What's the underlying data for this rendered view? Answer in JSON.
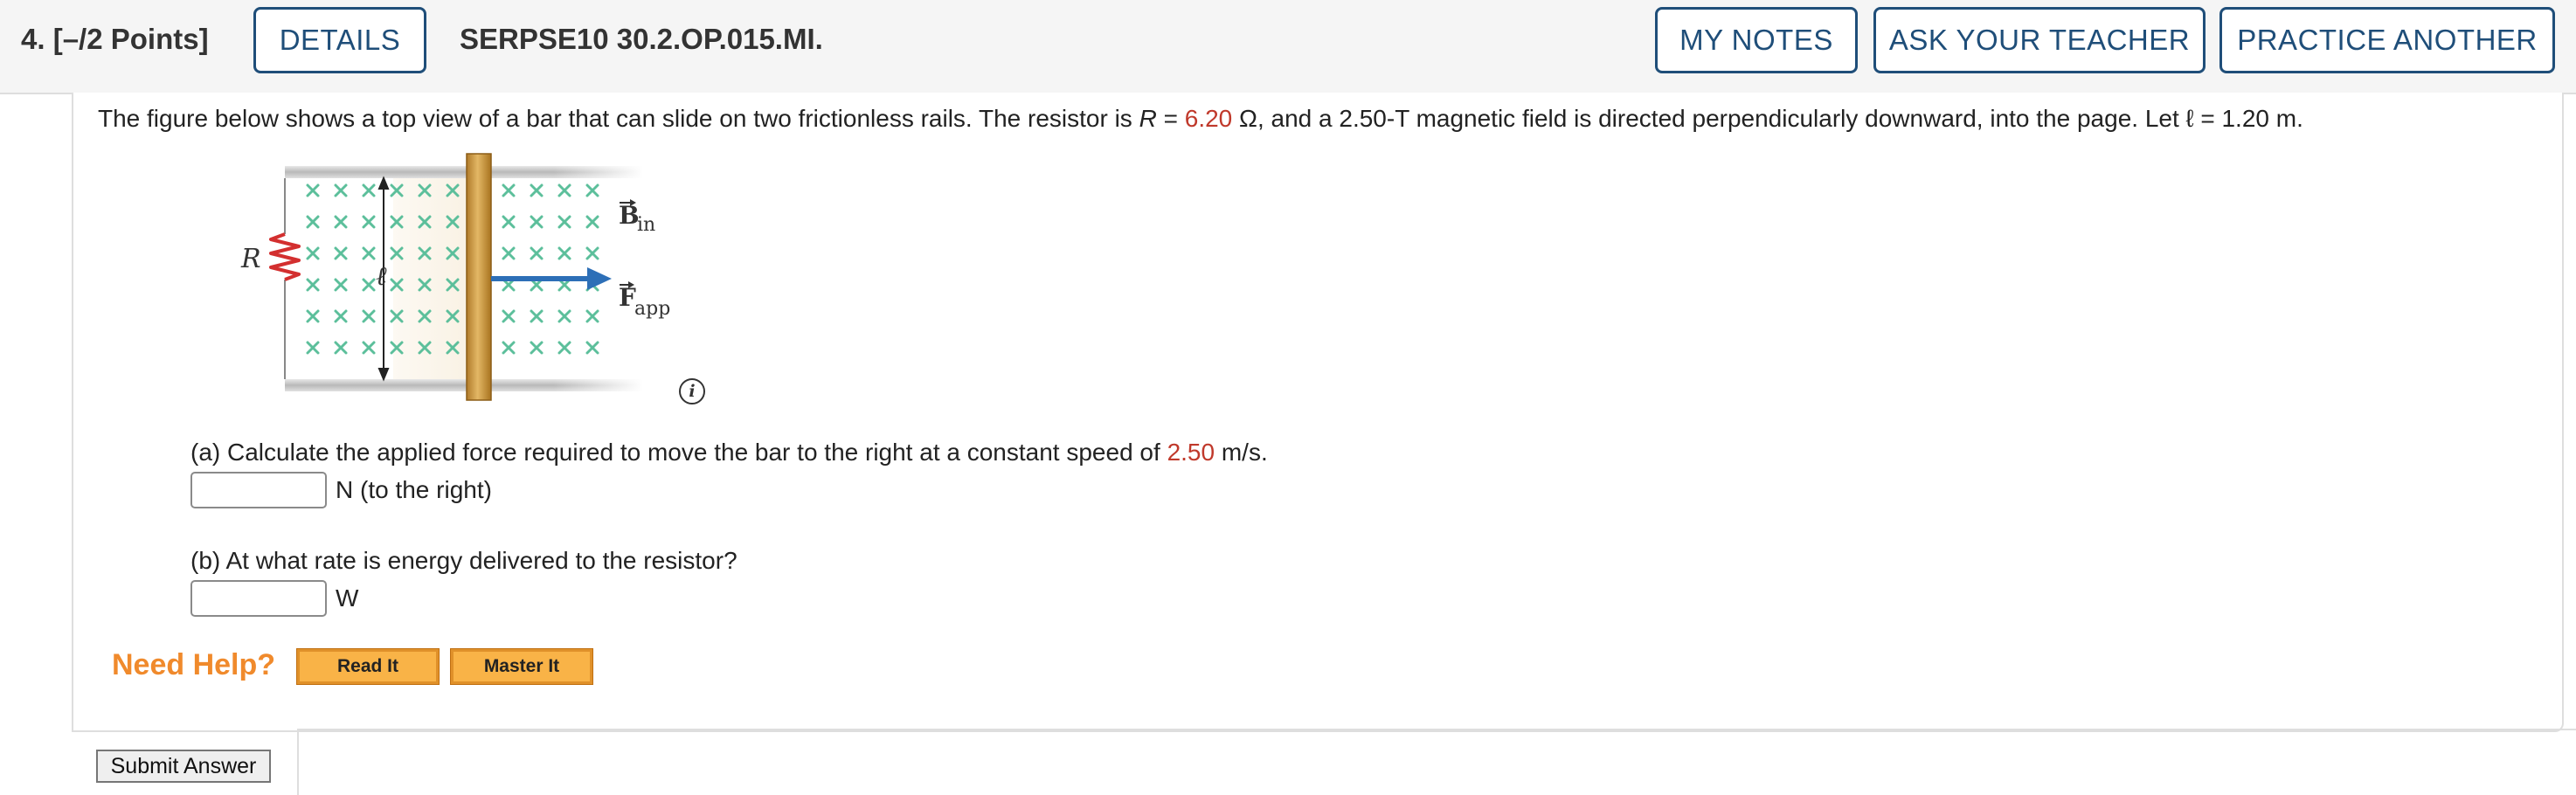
{
  "header": {
    "question_number": "4.",
    "points": "[–/2 Points]",
    "details_label": "DETAILS",
    "question_code": "SERPSE10 30.2.OP.015.MI.",
    "my_notes_label": "MY NOTES",
    "ask_teacher_label": "ASK YOUR TEACHER",
    "practice_another_label": "PRACTICE ANOTHER"
  },
  "problem": {
    "text_1": "The figure below shows a top view of a bar that can slide on two frictionless rails. The resistor is ",
    "R_symbol": "R",
    "equals": " = ",
    "R_value": "6.20",
    "text_2": " Ω, and a 2.50-T magnetic field is directed perpendicularly downward, into the page. Let ℓ = 1.20 m."
  },
  "figure": {
    "label_R": "R",
    "label_ell": "ℓ",
    "label_B": "B",
    "label_B_sub": "in",
    "label_F": "F",
    "label_F_sub": "app",
    "info_icon_text": "i"
  },
  "part_a": {
    "text_1": "(a) Calculate the applied force required to move the bar to the right at a constant speed of ",
    "speed_value": "2.50",
    "text_2": " m/s.",
    "input_value": "",
    "unit": "N (to the right)"
  },
  "part_b": {
    "text": "(b) At what rate is energy delivered to the resistor?",
    "input_value": "",
    "unit": "W"
  },
  "help": {
    "label": "Need Help?",
    "read_it_label": "Read It",
    "master_it_label": "Master It"
  },
  "submit_label": "Submit Answer",
  "colors": {
    "accent_blue": "#1f4e79",
    "value_red": "#c0392b",
    "need_help_orange": "#f08a2c",
    "help_button": "#f9b347",
    "field_marker_green": "#5cbf9b",
    "bar_brass": "#d4a24a"
  }
}
